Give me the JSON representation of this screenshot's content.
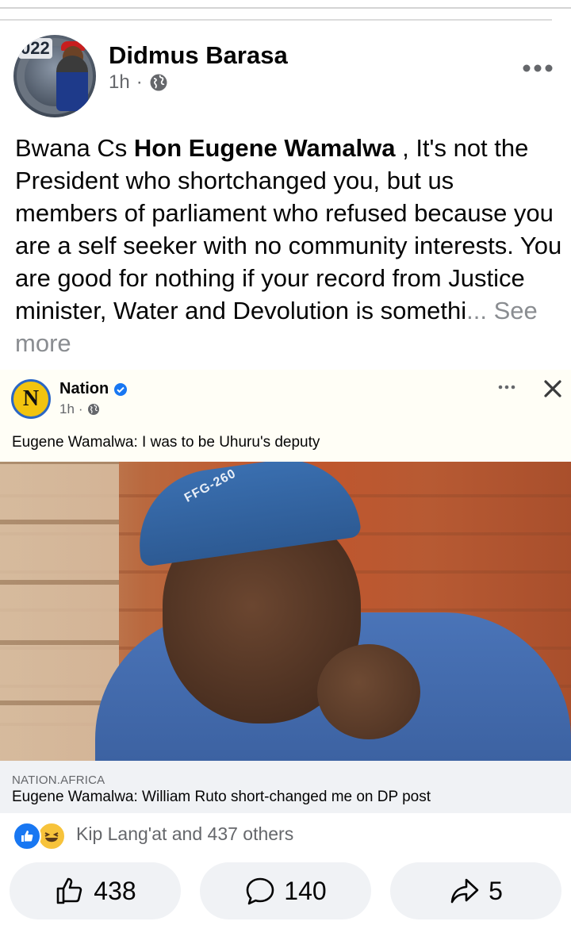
{
  "post": {
    "author": "Didmus Barasa",
    "time": "1h",
    "separator": "·",
    "avatar_badge": "022",
    "text_prefix": "Bwana Cs ",
    "text_bold": "Hon Eugene Wamalwa",
    "text_rest": " , It's not the President who shortchanged you, but us members of parliament who refused because you are a self seeker with no community interests. You are good for nothing if your record from Justice minister, Water and Devolution is somethi",
    "ellipsis": "...",
    "see_more": " See more"
  },
  "shared": {
    "page_name": "Nation",
    "logo_letter": "N",
    "time": "1h",
    "separator": "·",
    "text": "Eugene Wamalwa: I was to be Uhuru's deputy",
    "photo_cap_text": "FFG-260",
    "link_source": "NATION.AFRICA",
    "link_title": "Eugene Wamalwa: William Ruto short-changed me on DP post"
  },
  "reactions": {
    "summary": "Kip Lang'at and 437 others"
  },
  "actions": {
    "like_count": "438",
    "comment_count": "140",
    "share_count": "5"
  },
  "colors": {
    "facebook_blue": "#1877f2",
    "haha_yellow": "#f7c33b",
    "nation_yellow": "#f2c40f",
    "muted_gray": "#65676b"
  },
  "icons": [
    "globe-icon",
    "more-icon",
    "verified-icon",
    "close-icon",
    "like-icon",
    "haha-icon",
    "thumbs-up-icon",
    "comment-icon",
    "share-icon"
  ]
}
